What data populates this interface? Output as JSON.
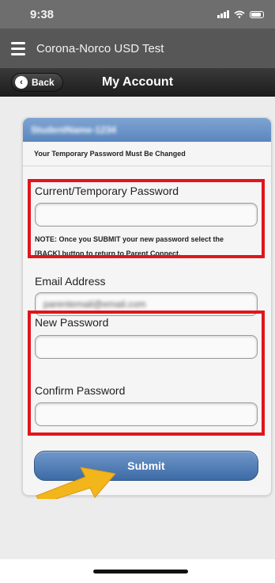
{
  "status_bar": {
    "time": "9:38"
  },
  "app_bar": {
    "title": "Corona-Norco USD Test"
  },
  "nav_bar": {
    "back_label": "Back",
    "title": "My Account"
  },
  "card": {
    "header_text": "StudentName-1234",
    "temp_message": "Your Temporary Password Must Be Changed"
  },
  "form": {
    "current_password_label": "Current/Temporary Password",
    "current_password_value": "",
    "note_line1": "NOTE: Once you SUBMIT your new password select the",
    "note_line2": "[BACK] button to return to Parent Connect.",
    "email_label": "Email Address",
    "email_value": "parentemail@email.com",
    "new_password_label": "New Password",
    "new_password_value": "",
    "confirm_password_label": "Confirm Password",
    "confirm_password_value": "",
    "submit_label": "Submit"
  },
  "colors": {
    "highlight_red": "#e2141b",
    "arrow_yellow": "#f2b51c",
    "header_blue": "#6a94c9"
  },
  "icons": [
    "menu-icon",
    "back-chevron-icon",
    "signal-icon",
    "wifi-icon",
    "battery-icon",
    "pointer-arrow-icon"
  ]
}
